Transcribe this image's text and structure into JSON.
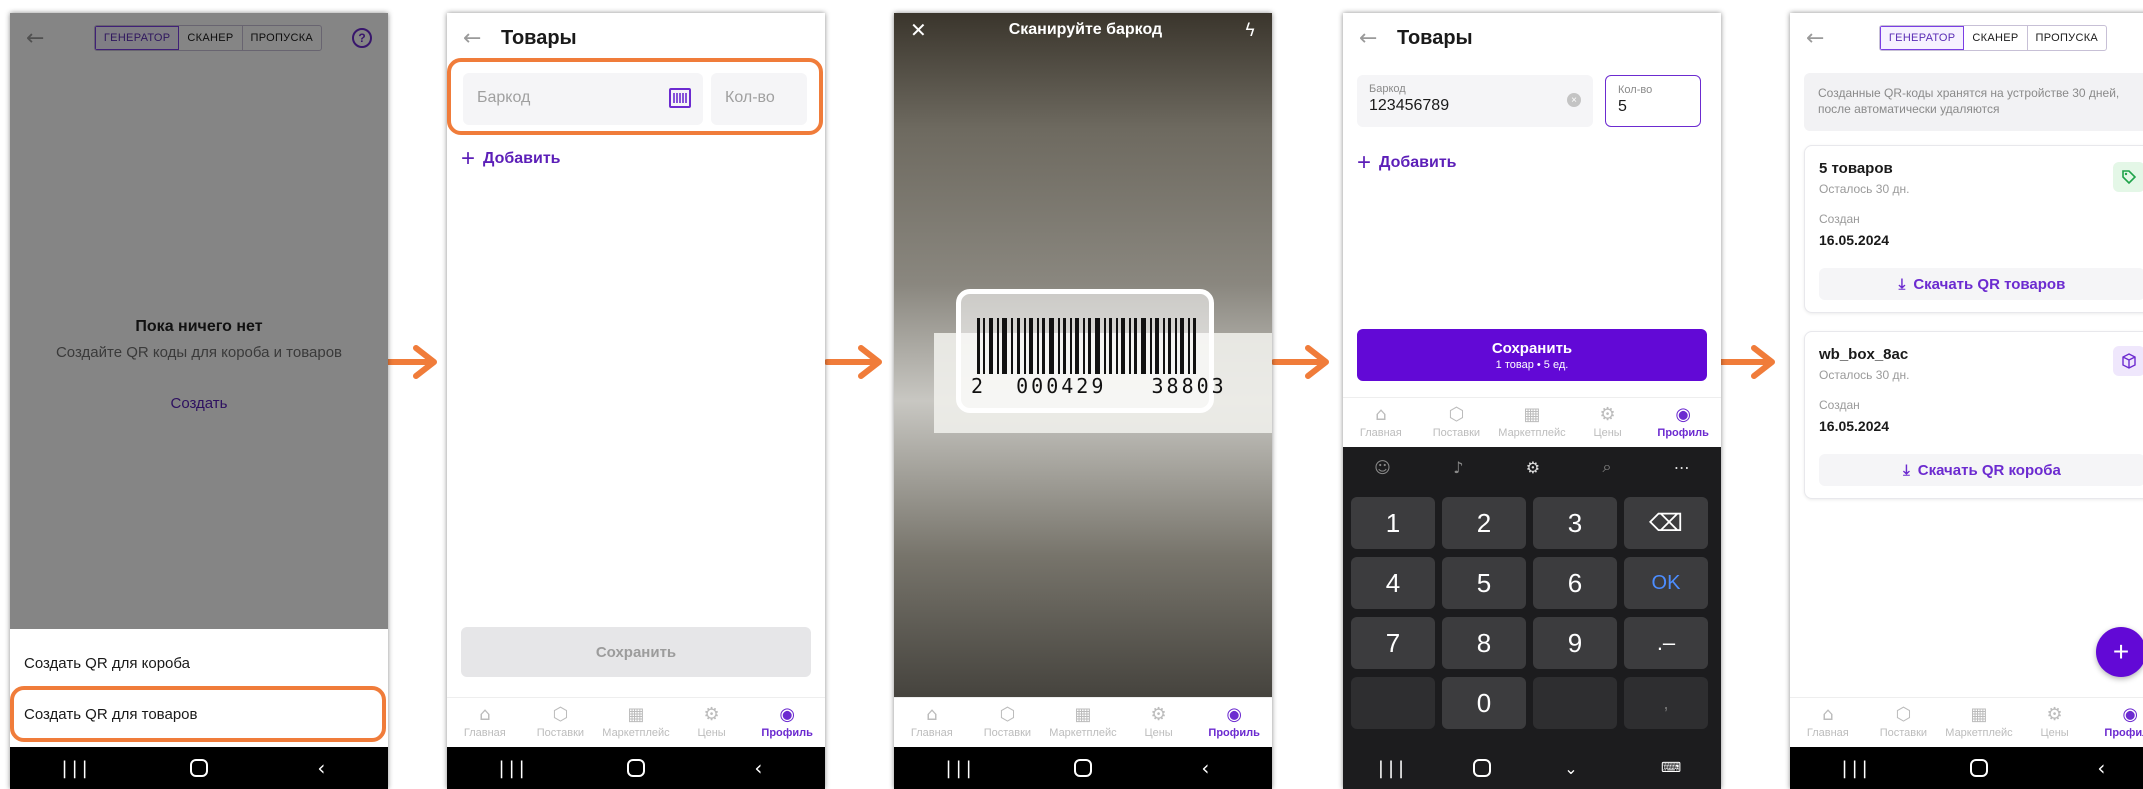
{
  "screen1": {
    "tabs": [
      "ГЕНЕРАТОР",
      "СКАНЕР",
      "ПРОПУСКА"
    ],
    "help_icon": "?",
    "empty_title": "Пока ничего нет",
    "empty_subtitle": "Создайте QR коды для короба и товаров",
    "create_link": "Создать",
    "sheet_item_box": "Создать QR для короба",
    "sheet_item_goods": "Создать QR для товаров"
  },
  "screen2": {
    "title": "Товары",
    "barcode_placeholder": "Баркод",
    "qty_placeholder": "Кол-во",
    "add_label": "Добавить",
    "save_label": "Сохранить"
  },
  "screen3": {
    "title": "Сканируйте баркод",
    "barcode_digits": "2  000429   38803"
  },
  "screen4": {
    "title": "Товары",
    "barcode_label": "Баркод",
    "barcode_value": "123456789",
    "qty_label": "Кол-во",
    "qty_value": "5",
    "add_label": "Добавить",
    "save_label": "Сохранить",
    "save_sub": "1 товар • 5 ед.",
    "keys": [
      "1",
      "2",
      "3",
      "4",
      "5",
      "6",
      "OK",
      "7",
      "8",
      "9",
      ".–",
      "0",
      ","
    ]
  },
  "screen5": {
    "tabs": [
      "ГЕНЕРАТОР",
      "СКАНЕР",
      "ПРОПУСКА"
    ],
    "info": "Созданные QR-коды хранятся на устройстве 30 дней, после автоматически удаляются",
    "card1": {
      "title": "5 товаров",
      "remain": "Осталось 30 дн.",
      "created_label": "Создан",
      "date": "16.05.2024",
      "download": "Скачать QR товаров"
    },
    "card2": {
      "title": "wb_box_8ac",
      "remain": "Осталось 30 дн.",
      "created_label": "Создан",
      "date": "16.05.2024",
      "download": "Скачать QR короба"
    },
    "fab": "+"
  },
  "bottom_tabs": [
    "Главная",
    "Поставки",
    "Маркетплейс",
    "Цены",
    "Профиль"
  ],
  "colors": {
    "accent": "#6c2bd0",
    "highlight": "#f07c3a",
    "arrow": "#f07c3a"
  }
}
